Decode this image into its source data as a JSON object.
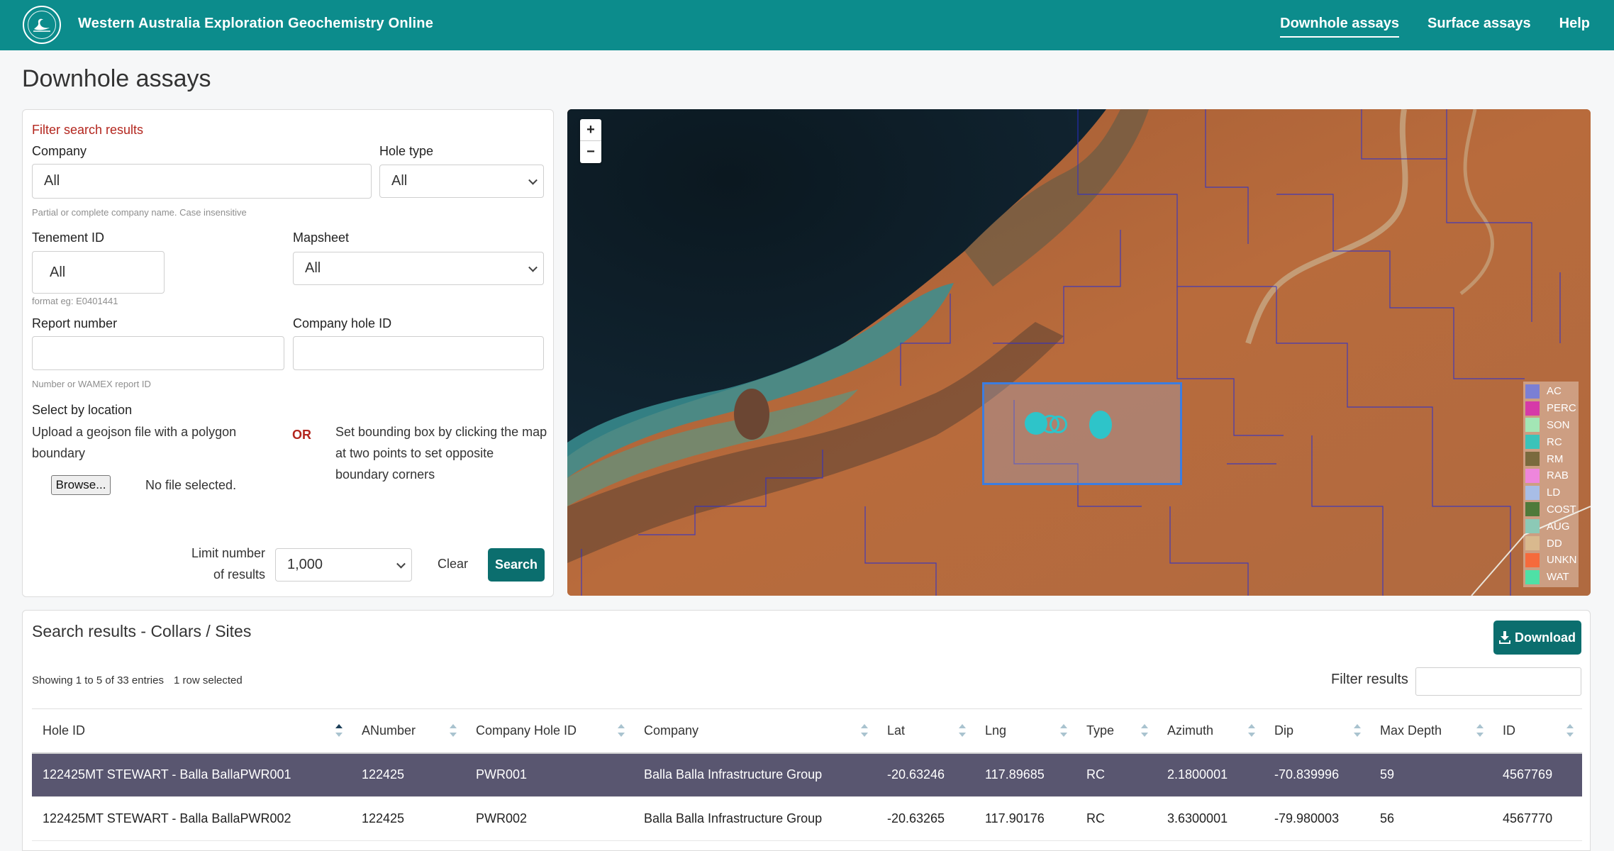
{
  "header": {
    "app_title": "Western Australia Exploration Geochemistry Online",
    "nav": [
      {
        "label": "Downhole assays",
        "active": true
      },
      {
        "label": "Surface assays",
        "active": false
      },
      {
        "label": "Help",
        "active": false
      }
    ]
  },
  "page_title": "Downhole assays",
  "filter": {
    "heading": "Filter search results",
    "company_label": "Company",
    "company_value": "All",
    "company_hint": "Partial or complete company name. Case insensitive",
    "hole_type_label": "Hole type",
    "hole_type_value": "All",
    "tenement_label": "Tenement ID",
    "tenement_value": "All",
    "tenement_hint": "format eg: E0401441",
    "mapsheet_label": "Mapsheet",
    "mapsheet_value": "All",
    "report_label": "Report number",
    "report_value": "",
    "report_hint": "Number or WAMEX report ID",
    "company_hole_label": "Company hole ID",
    "company_hole_value": "",
    "location_label": "Select by location",
    "upload_text_1": "Upload a geojson file with a polygon",
    "upload_text_2": "boundary",
    "or_label": "OR",
    "bbox_text_1": "Set bounding box by clicking the map",
    "bbox_text_2": "at two points to set opposite",
    "bbox_text_3": "boundary corners",
    "browse_label": "Browse...",
    "no_file_text": "No file selected.",
    "limit_label_1": "Limit number",
    "limit_label_2": "of results",
    "limit_value": "1,000",
    "clear_label": "Clear",
    "search_label": "Search"
  },
  "map": {
    "zoom_in": "+",
    "zoom_out": "−",
    "legend": [
      {
        "label": "AC",
        "color": "#7b7fd4"
      },
      {
        "label": "PERC",
        "color": "#d63aa8"
      },
      {
        "label": "SON",
        "color": "#a3e6b5"
      },
      {
        "label": "RC",
        "color": "#3bc3b9"
      },
      {
        "label": "RM",
        "color": "#7a6a3e"
      },
      {
        "label": "RAB",
        "color": "#ee86dc"
      },
      {
        "label": "LD",
        "color": "#a8bde6"
      },
      {
        "label": "COST",
        "color": "#4f7a3a"
      },
      {
        "label": "AUG",
        "color": "#8cc9b6"
      },
      {
        "label": "DD",
        "color": "#d9b98e"
      },
      {
        "label": "UNKN",
        "color": "#f56a3c"
      },
      {
        "label": "WAT",
        "color": "#4fe0a6"
      }
    ]
  },
  "results": {
    "title": "Search results - Collars / Sites",
    "download_label": "Download",
    "showing_text": "Showing 1 to 5 of 33 entries",
    "selected_text": "1 row selected",
    "filter_label": "Filter results",
    "filter_value": "",
    "columns": [
      "Hole ID",
      "ANumber",
      "Company Hole ID",
      "Company",
      "Lat",
      "Lng",
      "Type",
      "Azimuth",
      "Dip",
      "Max Depth",
      "ID"
    ],
    "rows": [
      [
        "122425MT STEWART - Balla BallaPWR001",
        "122425",
        "PWR001",
        "Balla Balla Infrastructure Group",
        "-20.63246",
        "117.89685",
        "RC",
        "2.1800001",
        "-70.839996",
        "59",
        "4567769"
      ],
      [
        "122425MT STEWART - Balla BallaPWR002",
        "122425",
        "PWR002",
        "Balla Balla Infrastructure Group",
        "-20.63265",
        "117.90176",
        "RC",
        "3.6300001",
        "-79.980003",
        "56",
        "4567770"
      ]
    ]
  }
}
